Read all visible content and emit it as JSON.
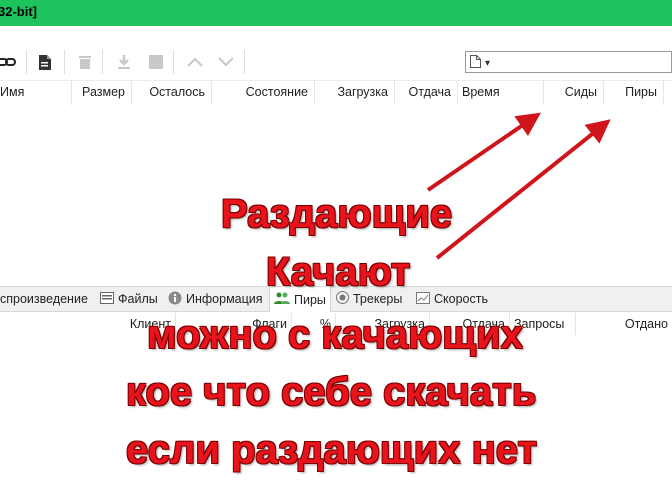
{
  "window": {
    "title_fragment": "32-bit]"
  },
  "toolbar": {
    "icons": [
      "link-icon",
      "new-file-icon",
      "delete-icon",
      "download-icon",
      "stop-icon",
      "move-up-icon",
      "move-down-icon"
    ],
    "filter_icon": "document-icon",
    "filter_arrow": "▾"
  },
  "torrent_columns": [
    "Имя",
    "Размер",
    "Осталось",
    "Состояние",
    "Загрузка",
    "Отдача",
    "Время",
    "Сиды",
    "Пиры"
  ],
  "detail_tabs": [
    {
      "label": "спроизведение",
      "icon": ""
    },
    {
      "label": "Файлы",
      "icon": "files-icon"
    },
    {
      "label": "Информация",
      "icon": "info-icon"
    },
    {
      "label": "Пиры",
      "icon": "peers-icon",
      "active": true
    },
    {
      "label": "Трекеры",
      "icon": "trackers-icon"
    },
    {
      "label": "Скорость",
      "icon": "speed-icon"
    }
  ],
  "peer_columns": [
    "Клиент",
    "Флаги",
    "%",
    "Загрузка",
    "Отдача",
    "Запросы",
    "Отдано"
  ],
  "annotations": {
    "line1": "Раздающие",
    "line2": "Качают",
    "line3": "можно с качающих",
    "line4": "кое что себе скачать",
    "line5": "если раздающих нет"
  },
  "colors": {
    "titlebar": "#1dc45e",
    "annotation": "#e8131b",
    "arrow": "#d0141c"
  }
}
